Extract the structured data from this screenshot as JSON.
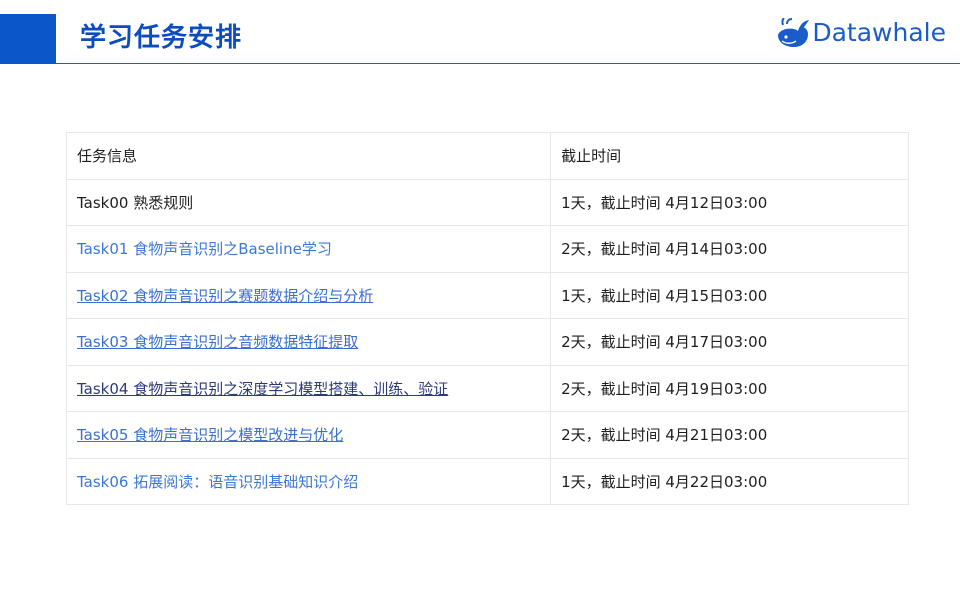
{
  "header": {
    "title": "学习任务安排",
    "logo_text": "Datawhale",
    "accent_color": "#0b56c9"
  },
  "table": {
    "columns": [
      "任务信息",
      "截止时间"
    ],
    "rows": [
      {
        "task": "Task00 熟悉规则",
        "deadline": "1天，截止时间 4月12日03:00",
        "style": "plain"
      },
      {
        "task": "Task01 食物声音识别之Baseline学习",
        "deadline": "2天，截止时间 4月14日03:00",
        "style": "link"
      },
      {
        "task": "Task02 食物声音识别之赛题数据介绍与分析",
        "deadline": "1天，截止时间 4月15日03:00",
        "style": "underlined"
      },
      {
        "task": "Task03 食物声音识别之音频数据特征提取",
        "deadline": "2天，截止时间 4月17日03:00",
        "style": "underlined"
      },
      {
        "task": "Task04 食物声音识别之深度学习模型搭建、训练、验证",
        "deadline": "2天，截止时间 4月19日03:00",
        "style": "underlined-dark"
      },
      {
        "task": "Task05 食物声音识别之模型改进与优化",
        "deadline": "2天，截止时间 4月21日03:00",
        "style": "underlined"
      },
      {
        "task": "Task06 拓展阅读：语音识别基础知识介绍",
        "deadline": "1天，截止时间 4月22日03:00",
        "style": "link"
      }
    ]
  }
}
